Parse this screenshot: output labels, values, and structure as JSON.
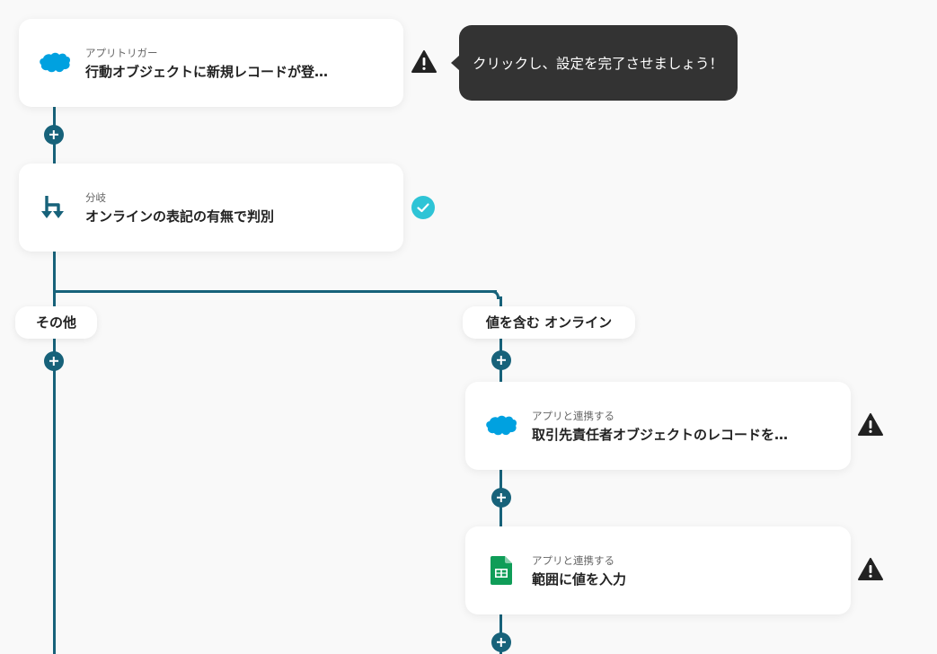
{
  "nodes": {
    "trigger": {
      "subtitle": "アプリトリガー",
      "title": "行動オブジェクトに新規レコードが登…",
      "icon": "salesforce-cloud-icon",
      "status": "warning-icon"
    },
    "branch": {
      "subtitle": "分岐",
      "title": "オンラインの表記の有無で判別",
      "icon": "branch-icon",
      "status": "check-icon"
    },
    "action1": {
      "subtitle": "アプリと連携する",
      "title": "取引先責任者オブジェクトのレコードを…",
      "icon": "salesforce-cloud-icon",
      "status": "warning-icon"
    },
    "action2": {
      "subtitle": "アプリと連携する",
      "title": "範囲に値を入力",
      "icon": "google-sheets-icon",
      "status": "warning-icon"
    }
  },
  "tooltip": {
    "text": "クリックし、設定を完了させましょう！"
  },
  "branches": {
    "left_label": "その他",
    "right_label": "値を含む オンライン"
  },
  "colors": {
    "connector": "#17627a",
    "tooltip_bg": "#333333",
    "check": "#2ec4d6",
    "salesforce": "#00a1e0",
    "sheets": "#0f9d58"
  }
}
